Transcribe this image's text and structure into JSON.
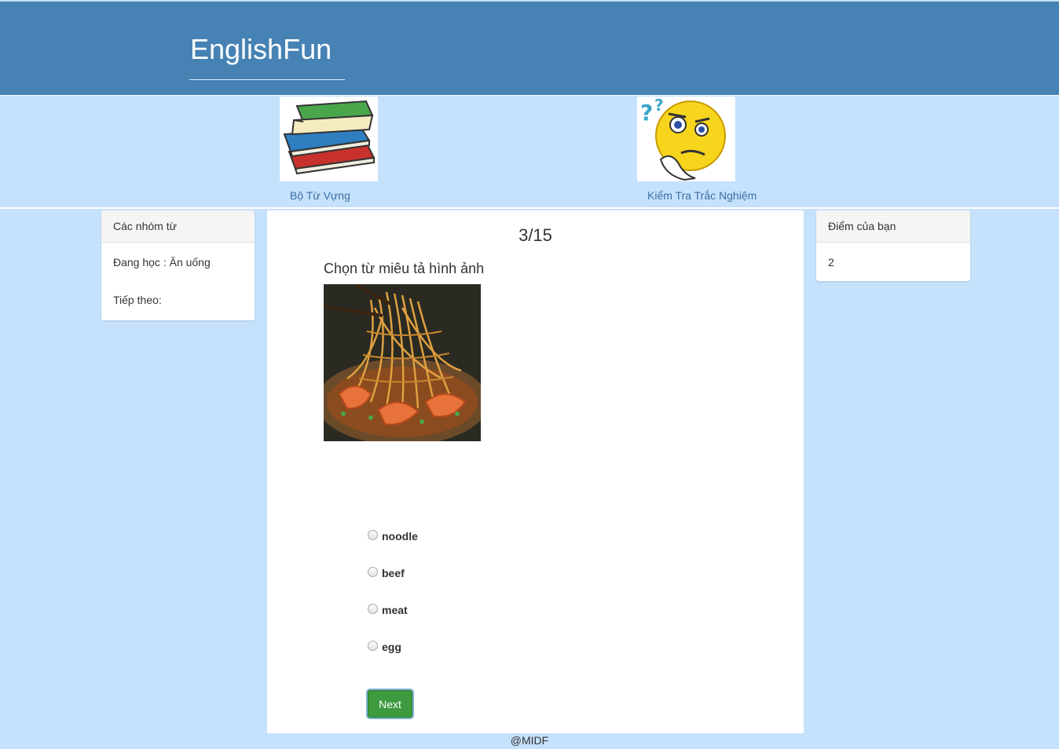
{
  "header": {
    "brand": "EnglishFun"
  },
  "nav": {
    "items": [
      {
        "label": "Bộ Từ Vựng",
        "icon": "books-icon"
      },
      {
        "label": "Kiểm Tra Trắc Nghiệm",
        "icon": "thinking-face-icon"
      }
    ]
  },
  "left_panel": {
    "heading": "Các nhóm từ",
    "studying": "Đang học : Ăn uống",
    "next": "Tiếp theo:"
  },
  "right_panel": {
    "heading": "Điểm của bạn",
    "score": "2"
  },
  "quiz": {
    "counter": "3/15",
    "progress": {
      "current": 3,
      "total": 15
    },
    "question": "Chọn từ miêu tả hình ảnh",
    "image": "noodles-with-shrimp-photo",
    "options": [
      "noodle",
      "beef",
      "meat",
      "egg"
    ],
    "next_label": "Next"
  },
  "footer": {
    "text": "@MIDF"
  }
}
